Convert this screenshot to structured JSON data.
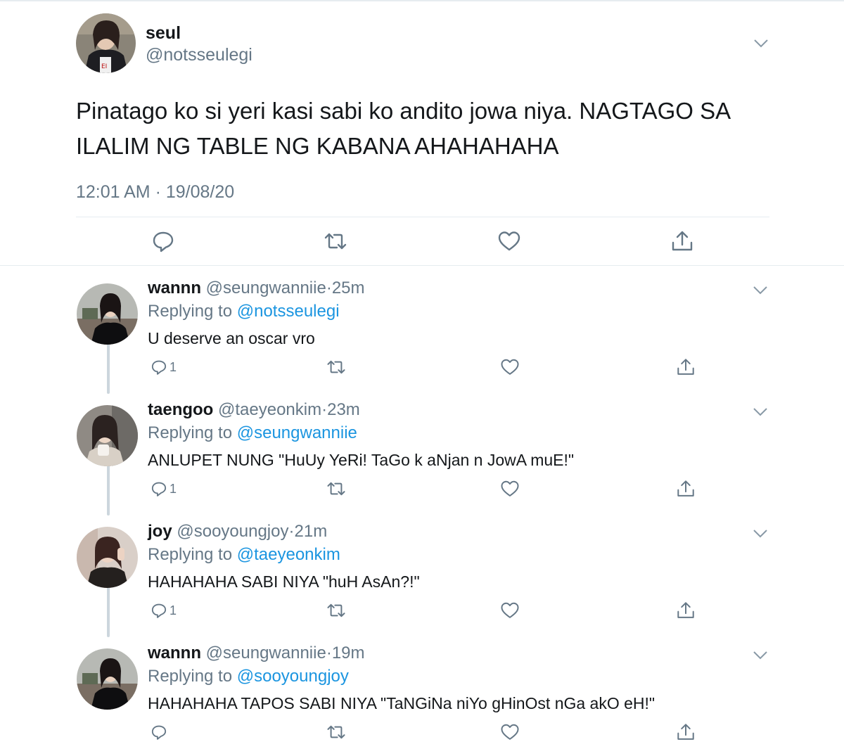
{
  "main_tweet": {
    "display_name": "seul",
    "handle": "@notsseulegi",
    "text": "Pinatago ko si yeri kasi sabi ko andito jowa niya. NAGTAGO SA ILALIM NG TABLE NG KABANA AHAHAHAHA",
    "timestamp": "12:01 AM · 19/08/20",
    "actions": [
      "reply-icon",
      "retweet-icon",
      "like-icon",
      "share-icon"
    ]
  },
  "replies": [
    {
      "display_name": "wannn",
      "handle": "@seungwanniie",
      "separator": "·",
      "time": "25m",
      "replying_label": "Replying to",
      "replying_to": "@notsseulegi",
      "text": "U deserve an oscar vro",
      "reply_count": "1"
    },
    {
      "display_name": "taengoo",
      "handle": "@taeyeonkim",
      "separator": "·",
      "time": "23m",
      "replying_label": "Replying to",
      "replying_to": "@seungwanniie",
      "text": "ANLUPET NUNG \"HuUy YeRi! TaGo k aNjan n JowA muE!\"",
      "reply_count": "1"
    },
    {
      "display_name": "joy",
      "handle": "@sooyoungjoy",
      "separator": "·",
      "time": "21m",
      "replying_label": "Replying to",
      "replying_to": "@taeyeonkim",
      "text": "HAHAHAHA SABI NIYA \"huH AsAn?!\"",
      "reply_count": "1"
    },
    {
      "display_name": "wannn",
      "handle": "@seungwanniie",
      "separator": "·",
      "time": "19m",
      "replying_label": "Replying to",
      "replying_to": "@sooyoungjoy",
      "text": "HAHAHAHA TAPOS SABI NIYA \"TaNGiNa niYo gHinOst nGa akO eH!\"",
      "reply_count": ""
    }
  ],
  "colors": {
    "text": "#14171a",
    "secondary": "#657786",
    "link": "#1b95e0",
    "divider": "#e6ecf0",
    "thread_line": "#ccd6dd"
  }
}
